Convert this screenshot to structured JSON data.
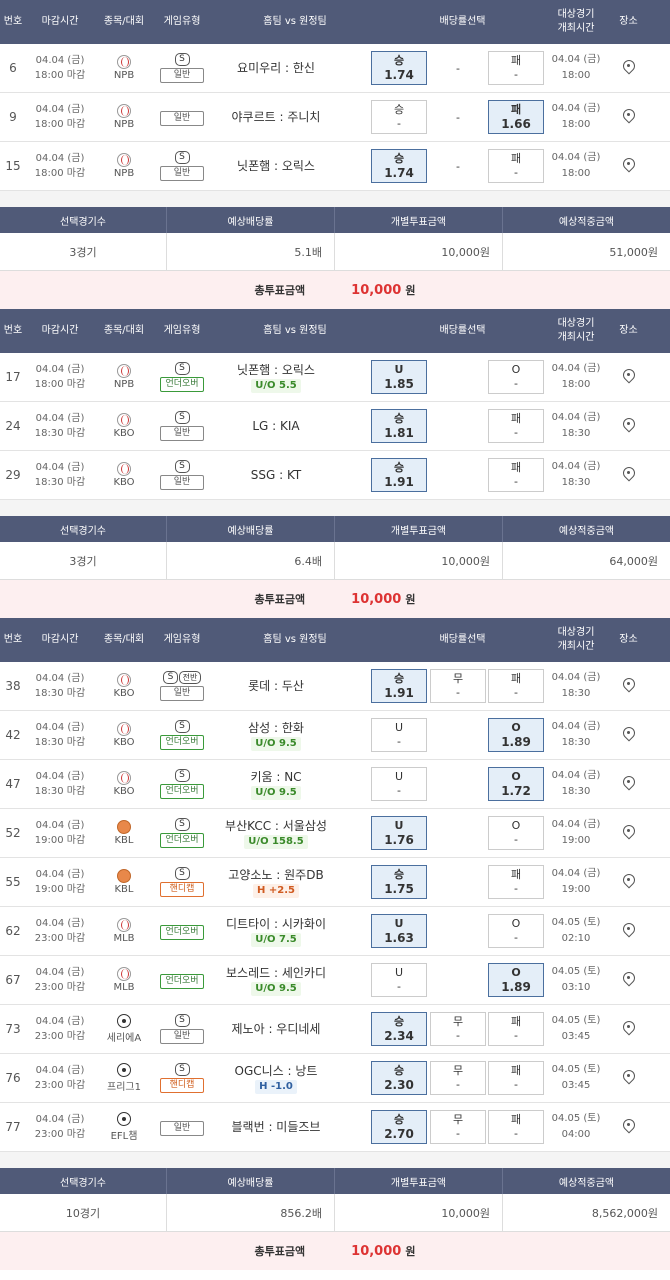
{
  "header": {
    "no": "번호",
    "close": "마감시간",
    "league": "종목/대회",
    "type": "게임유형",
    "teams": "홈팀 vs 원정팀",
    "odds": "배당률선택",
    "date1": "대상경기",
    "date2": "개최시간",
    "loc": "장소"
  },
  "summary_labels": {
    "count": "선택경기수",
    "odds": "예상배당률",
    "bet": "개별투표금액",
    "win": "예상적중금액",
    "total": "총투표금액"
  },
  "sections": [
    {
      "rows": [
        {
          "no": "6",
          "date": "04.04 (금)",
          "close": "18:00 마감",
          "sport": "baseball",
          "league": "NPB",
          "badge": "S",
          "type": "일반",
          "tc": "",
          "teams": "요미우리 : 한신",
          "sub": "",
          "sc": "",
          "mode": "3",
          "opts": [
            {
              "l": "승",
              "o": "1.74",
              "s": true
            },
            {
              "l": "-",
              "o": ""
            },
            {
              "l": "패",
              "o": "-",
              "s": false
            }
          ],
          "gdate": "04.04 (금)",
          "gtime": "18:00"
        },
        {
          "no": "9",
          "date": "04.04 (금)",
          "close": "18:00 마감",
          "sport": "baseball",
          "league": "NPB",
          "badge": "",
          "type": "일반",
          "tc": "",
          "teams": "야쿠르트 : 주니치",
          "sub": "",
          "sc": "",
          "mode": "3",
          "opts": [
            {
              "l": "승",
              "o": "-",
              "s": false
            },
            {
              "l": "-",
              "o": ""
            },
            {
              "l": "패",
              "o": "1.66",
              "s": true
            }
          ],
          "gdate": "04.04 (금)",
          "gtime": "18:00"
        },
        {
          "no": "15",
          "date": "04.04 (금)",
          "close": "18:00 마감",
          "sport": "baseball",
          "league": "NPB",
          "badge": "S",
          "type": "일반",
          "tc": "",
          "teams": "닛폰햄 : 오릭스",
          "sub": "",
          "sc": "",
          "mode": "3",
          "opts": [
            {
              "l": "승",
              "o": "1.74",
              "s": true
            },
            {
              "l": "-",
              "o": ""
            },
            {
              "l": "패",
              "o": "-",
              "s": false
            }
          ],
          "gdate": "04.04 (금)",
          "gtime": "18:00"
        }
      ],
      "summary": {
        "count": "3경기",
        "odds": "5.1배",
        "bet": "10,000원",
        "win": "51,000원",
        "total": "10,000",
        "unit": "원"
      }
    },
    {
      "rows": [
        {
          "no": "17",
          "date": "04.04 (금)",
          "close": "18:00 마감",
          "sport": "baseball",
          "league": "NPB",
          "badge": "S",
          "type": "언더오버",
          "tc": "uo",
          "teams": "닛폰햄 : 오릭스",
          "sub": "U/O 5.5",
          "sc": "uo",
          "mode": "2",
          "opts": [
            {
              "l": "U",
              "o": "1.85",
              "s": true
            },
            {
              "l": "O",
              "o": "-",
              "s": false
            }
          ],
          "gdate": "04.04 (금)",
          "gtime": "18:00"
        },
        {
          "no": "24",
          "date": "04.04 (금)",
          "close": "18:30 마감",
          "sport": "baseball",
          "league": "KBO",
          "badge": "S",
          "type": "일반",
          "tc": "",
          "teams": "LG : KIA",
          "sub": "",
          "sc": "",
          "mode": "2",
          "opts": [
            {
              "l": "승",
              "o": "1.81",
              "s": true
            },
            {
              "l": "패",
              "o": "-",
              "s": false
            }
          ],
          "gdate": "04.04 (금)",
          "gtime": "18:30"
        },
        {
          "no": "29",
          "date": "04.04 (금)",
          "close": "18:30 마감",
          "sport": "baseball",
          "league": "KBO",
          "badge": "S",
          "type": "일반",
          "tc": "",
          "teams": "SSG : KT",
          "sub": "",
          "sc": "",
          "mode": "2",
          "opts": [
            {
              "l": "승",
              "o": "1.91",
              "s": true
            },
            {
              "l": "패",
              "o": "-",
              "s": false
            }
          ],
          "gdate": "04.04 (금)",
          "gtime": "18:30"
        }
      ],
      "summary": {
        "count": "3경기",
        "odds": "6.4배",
        "bet": "10,000원",
        "win": "64,000원",
        "total": "10,000",
        "unit": "원"
      }
    },
    {
      "rows": [
        {
          "no": "38",
          "date": "04.04 (금)",
          "close": "18:30 마감",
          "sport": "baseball",
          "league": "KBO",
          "badge": "S",
          "badge2": "전반",
          "type": "일반",
          "tc": "",
          "teams": "롯데 : 두산",
          "sub": "",
          "sc": "",
          "mode": "3b",
          "opts": [
            {
              "l": "승",
              "o": "1.91",
              "s": true
            },
            {
              "l": "무",
              "o": "-",
              "s": false
            },
            {
              "l": "패",
              "o": "-",
              "s": false
            }
          ],
          "gdate": "04.04 (금)",
          "gtime": "18:30"
        },
        {
          "no": "42",
          "date": "04.04 (금)",
          "close": "18:30 마감",
          "sport": "baseball",
          "league": "KBO",
          "badge": "S",
          "type": "언더오버",
          "tc": "uo",
          "teams": "삼성 : 한화",
          "sub": "U/O 9.5",
          "sc": "uo",
          "mode": "2",
          "opts": [
            {
              "l": "U",
              "o": "-",
              "s": false
            },
            {
              "l": "O",
              "o": "1.89",
              "s": true
            }
          ],
          "gdate": "04.04 (금)",
          "gtime": "18:30"
        },
        {
          "no": "47",
          "date": "04.04 (금)",
          "close": "18:30 마감",
          "sport": "baseball",
          "league": "KBO",
          "badge": "S",
          "type": "언더오버",
          "tc": "uo",
          "teams": "키움 : NC",
          "sub": "U/O 9.5",
          "sc": "uo",
          "mode": "2",
          "opts": [
            {
              "l": "U",
              "o": "-",
              "s": false
            },
            {
              "l": "O",
              "o": "1.72",
              "s": true
            }
          ],
          "gdate": "04.04 (금)",
          "gtime": "18:30"
        },
        {
          "no": "52",
          "date": "04.04 (금)",
          "close": "19:00 마감",
          "sport": "basketball",
          "league": "KBL",
          "badge": "S",
          "type": "언더오버",
          "tc": "uo",
          "teams": "부산KCC : 서울삼성",
          "sub": "U/O 158.5",
          "sc": "uo",
          "mode": "2",
          "opts": [
            {
              "l": "U",
              "o": "1.76",
              "s": true
            },
            {
              "l": "O",
              "o": "-",
              "s": false
            }
          ],
          "gdate": "04.04 (금)",
          "gtime": "19:00"
        },
        {
          "no": "55",
          "date": "04.04 (금)",
          "close": "19:00 마감",
          "sport": "basketball",
          "league": "KBL",
          "badge": "S",
          "type": "핸디캡",
          "tc": "hc",
          "teams": "고양소노 : 원주DB",
          "sub": "H +2.5",
          "sc": "hp",
          "mode": "2",
          "opts": [
            {
              "l": "승",
              "o": "1.75",
              "s": true
            },
            {
              "l": "패",
              "o": "-",
              "s": false
            }
          ],
          "gdate": "04.04 (금)",
          "gtime": "19:00"
        },
        {
          "no": "62",
          "date": "04.04 (금)",
          "close": "23:00 마감",
          "sport": "baseball",
          "league": "MLB",
          "badge": "",
          "type": "언더오버",
          "tc": "uo",
          "teams": "디트타이 : 시카화이",
          "sub": "U/O 7.5",
          "sc": "uo",
          "mode": "2",
          "opts": [
            {
              "l": "U",
              "o": "1.63",
              "s": true
            },
            {
              "l": "O",
              "o": "-",
              "s": false
            }
          ],
          "gdate": "04.05 (토)",
          "gtime": "02:10"
        },
        {
          "no": "67",
          "date": "04.04 (금)",
          "close": "23:00 마감",
          "sport": "baseball",
          "league": "MLB",
          "badge": "",
          "type": "언더오버",
          "tc": "uo",
          "teams": "보스레드 : 세인카디",
          "sub": "U/O 9.5",
          "sc": "uo",
          "mode": "2",
          "opts": [
            {
              "l": "U",
              "o": "-",
              "s": false
            },
            {
              "l": "O",
              "o": "1.89",
              "s": true
            }
          ],
          "gdate": "04.05 (토)",
          "gtime": "03:10"
        },
        {
          "no": "73",
          "date": "04.04 (금)",
          "close": "23:00 마감",
          "sport": "soccer",
          "league": "세리에A",
          "badge": "S",
          "type": "일반",
          "tc": "",
          "teams": "제노아 : 우디네세",
          "sub": "",
          "sc": "",
          "mode": "3b",
          "opts": [
            {
              "l": "승",
              "o": "2.34",
              "s": true
            },
            {
              "l": "무",
              "o": "-",
              "s": false
            },
            {
              "l": "패",
              "o": "-",
              "s": false
            }
          ],
          "gdate": "04.05 (토)",
          "gtime": "03:45"
        },
        {
          "no": "76",
          "date": "04.04 (금)",
          "close": "23:00 마감",
          "sport": "soccer",
          "league": "프리그1",
          "badge": "S",
          "type": "핸디캡",
          "tc": "hc",
          "teams": "OGC니스 : 낭트",
          "sub": "H -1.0",
          "sc": "hm",
          "mode": "3b",
          "opts": [
            {
              "l": "승",
              "o": "2.30",
              "s": true
            },
            {
              "l": "무",
              "o": "-",
              "s": false
            },
            {
              "l": "패",
              "o": "-",
              "s": false
            }
          ],
          "gdate": "04.05 (토)",
          "gtime": "03:45"
        },
        {
          "no": "77",
          "date": "04.04 (금)",
          "close": "23:00 마감",
          "sport": "soccer",
          "league": "EFL챔",
          "badge": "",
          "type": "일반",
          "tc": "",
          "teams": "블랙번 : 미들즈브",
          "sub": "",
          "sc": "",
          "mode": "3b",
          "opts": [
            {
              "l": "승",
              "o": "2.70",
              "s": true
            },
            {
              "l": "무",
              "o": "-",
              "s": false
            },
            {
              "l": "패",
              "o": "-",
              "s": false
            }
          ],
          "gdate": "04.05 (토)",
          "gtime": "04:00"
        }
      ],
      "summary": {
        "count": "10경기",
        "odds": "856.2배",
        "bet": "10,000원",
        "win": "8,562,000원",
        "total": "10,000",
        "unit": "원"
      }
    }
  ]
}
